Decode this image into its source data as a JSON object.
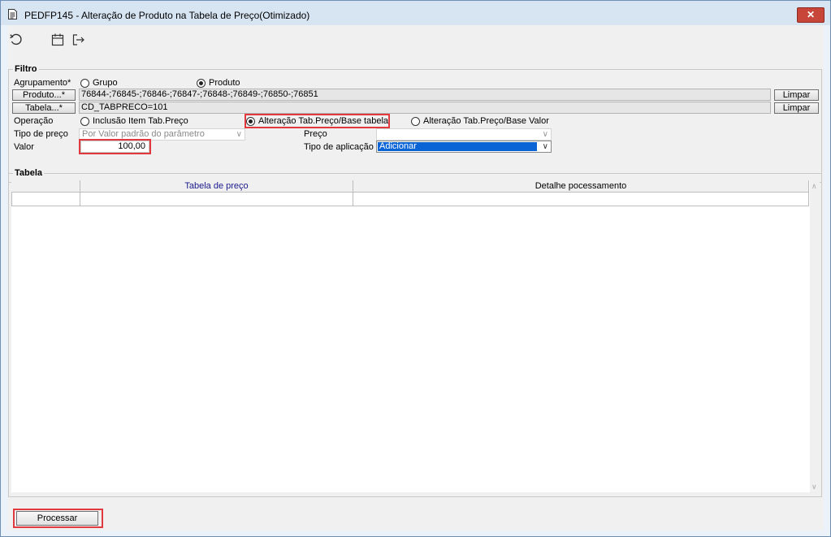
{
  "window": {
    "title": "PEDFP145 - Alteração de Produto na Tabela de Preço(Otimizado)",
    "close_label": "✕",
    "icons": [
      "document-icon",
      "refresh-icon",
      "calendar-icon",
      "exit-icon"
    ]
  },
  "filtro": {
    "legend": "Filtro",
    "agrupamento": {
      "label": "Agrupamento*",
      "options": [
        {
          "label": "Grupo",
          "selected": false
        },
        {
          "label": "Produto",
          "selected": true
        }
      ]
    },
    "produto": {
      "button_label": "Produto...*",
      "value": "76844-;76845-;76846-;76847-;76848-;76849-;76850-;76851",
      "clear_label": "Limpar"
    },
    "tabela": {
      "button_label": "Tabela...*",
      "value": "CD_TABPRECO=101",
      "clear_label": "Limpar"
    },
    "operacao": {
      "label": "Operação",
      "options": [
        {
          "label": "Inclusão Item Tab.Preço",
          "selected": false
        },
        {
          "label": "Alteração Tab.Preço/Base tabela",
          "selected": true
        },
        {
          "label": "Alteração Tab.Preço/Base Valor",
          "selected": false
        }
      ]
    },
    "tipo_preco": {
      "label": "Tipo de preço",
      "value": "Por Valor padrão do parâmetro"
    },
    "preco": {
      "label": "Preço",
      "value": ""
    },
    "valor": {
      "label": "Valor",
      "value": "100,00"
    },
    "tipo_aplicacao": {
      "label": "Tipo de aplicação",
      "value": "Adicionar"
    }
  },
  "tabela_section": {
    "legend": "Tabela",
    "columns": [
      "",
      "Tabela de preço",
      "Detalhe pocessamento"
    ],
    "rows": [
      [
        "",
        "",
        ""
      ]
    ]
  },
  "footer": {
    "process_label": "Processar"
  },
  "colors": {
    "highlight_border": "#e0393e",
    "selection_blue": "#0a64d6",
    "header_link_blue": "#1a1a8c"
  }
}
